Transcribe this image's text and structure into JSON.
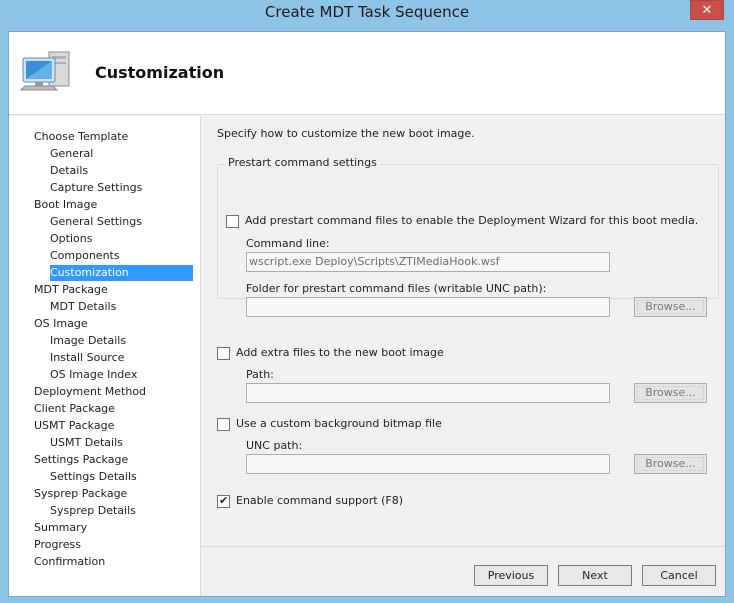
{
  "window": {
    "title": "Create MDT Task Sequence",
    "close_glyph": "✕"
  },
  "header": {
    "title": "Customization"
  },
  "nav": {
    "items": [
      {
        "label": "Choose Template",
        "level": 0
      },
      {
        "label": "General",
        "level": 1
      },
      {
        "label": "Details",
        "level": 1
      },
      {
        "label": "Capture Settings",
        "level": 1
      },
      {
        "label": "Boot Image",
        "level": 0
      },
      {
        "label": "General Settings",
        "level": 1
      },
      {
        "label": "Options",
        "level": 1
      },
      {
        "label": "Components",
        "level": 1
      },
      {
        "label": "Customization",
        "level": 1,
        "selected": true
      },
      {
        "label": "MDT Package",
        "level": 0
      },
      {
        "label": "MDT Details",
        "level": 1
      },
      {
        "label": "OS Image",
        "level": 0
      },
      {
        "label": "Image Details",
        "level": 1
      },
      {
        "label": "Install Source",
        "level": 1
      },
      {
        "label": "OS Image Index",
        "level": 1
      },
      {
        "label": "Deployment Method",
        "level": 0
      },
      {
        "label": "Client Package",
        "level": 0
      },
      {
        "label": "USMT Package",
        "level": 0
      },
      {
        "label": "USMT Details",
        "level": 1
      },
      {
        "label": "Settings Package",
        "level": 0
      },
      {
        "label": "Settings Details",
        "level": 1
      },
      {
        "label": "Sysprep Package",
        "level": 0
      },
      {
        "label": "Sysprep Details",
        "level": 1
      },
      {
        "label": "Summary",
        "level": 0
      },
      {
        "label": "Progress",
        "level": 0
      },
      {
        "label": "Confirmation",
        "level": 0
      }
    ]
  },
  "main": {
    "description": "Specify how to customize the new boot image.",
    "prestart": {
      "group_title": "Prestart command settings",
      "checkbox_label": "Add prestart command files to enable the Deployment Wizard for this boot media.",
      "checked": false,
      "command_line_label": "Command line:",
      "command_line_value": "wscript.exe Deploy\\Scripts\\ZTIMediaHook.wsf",
      "folder_label": "Folder for prestart command files (writable UNC path):",
      "folder_value": "",
      "browse_label": "Browse..."
    },
    "extra_files": {
      "checkbox_label": "Add extra files to the new boot image",
      "checked": false,
      "path_label": "Path:",
      "path_value": "",
      "browse_label": "Browse..."
    },
    "background": {
      "checkbox_label": "Use a custom background bitmap file",
      "checked": false,
      "unc_label": "UNC path:",
      "unc_value": "",
      "browse_label": "Browse..."
    },
    "command_support": {
      "checkbox_label": "Enable command support (F8)",
      "checked": true
    }
  },
  "footer": {
    "previous_label": "Previous",
    "next_label": "Next",
    "cancel_label": "Cancel"
  }
}
